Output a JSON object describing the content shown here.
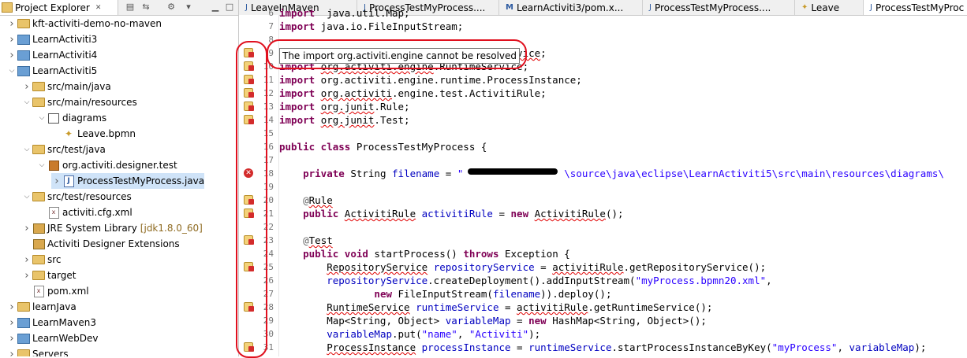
{
  "explorer": {
    "tab_label": "Project Explorer",
    "tab_close": "✕",
    "items": [
      {
        "label": "kft-activiti-demo-no-maven",
        "icon": "project-icon",
        "level": 0,
        "expanded": false,
        "selected": false
      },
      {
        "label": "LearnActiviti3",
        "icon": "maven-project-icon",
        "level": 0,
        "expanded": false,
        "selected": false
      },
      {
        "label": "LearnActiviti4",
        "icon": "maven-project-icon",
        "level": 0,
        "expanded": false,
        "selected": false
      },
      {
        "label": "LearnActiviti5",
        "icon": "maven-project-icon",
        "level": 0,
        "expanded": true,
        "selected": false
      },
      {
        "label": "src/main/java",
        "icon": "source-folder-icon",
        "level": 1,
        "expanded": false,
        "selected": false
      },
      {
        "label": "src/main/resources",
        "icon": "source-folder-icon",
        "level": 1,
        "expanded": true,
        "selected": false
      },
      {
        "label": "diagrams",
        "icon": "diagram-folder-icon",
        "level": 2,
        "expanded": true,
        "selected": false
      },
      {
        "label": "Leave.bpmn",
        "icon": "bpmn-file-icon",
        "level": 3,
        "expanded": null,
        "selected": false
      },
      {
        "label": "src/test/java",
        "icon": "source-folder-icon",
        "level": 1,
        "expanded": true,
        "selected": false
      },
      {
        "label": "org.activiti.designer.test",
        "icon": "package-icon",
        "level": 2,
        "expanded": true,
        "selected": false
      },
      {
        "label": "ProcessTestMyProcess.java",
        "icon": "java-file-icon",
        "level": 3,
        "expanded": false,
        "selected": true
      },
      {
        "label": "src/test/resources",
        "icon": "source-folder-icon",
        "level": 1,
        "expanded": true,
        "selected": false
      },
      {
        "label": "activiti.cfg.xml",
        "icon": "xml-file-icon",
        "level": 2,
        "expanded": null,
        "selected": false
      },
      {
        "label": "JRE System Library",
        "decoration": "[jdk1.8.0_60]",
        "icon": "library-icon",
        "level": 1,
        "expanded": false,
        "selected": false
      },
      {
        "label": "Activiti Designer Extensions",
        "icon": "library-icon",
        "level": 1,
        "expanded": null,
        "selected": false
      },
      {
        "label": "src",
        "icon": "folder-icon",
        "level": 1,
        "expanded": false,
        "selected": false
      },
      {
        "label": "target",
        "icon": "folder-icon",
        "level": 1,
        "expanded": false,
        "selected": false
      },
      {
        "label": "pom.xml",
        "icon": "xml-file-icon",
        "level": 1,
        "expanded": null,
        "selected": false
      },
      {
        "label": "learnJava",
        "icon": "project-icon",
        "level": 0,
        "expanded": false,
        "selected": false
      },
      {
        "label": "LearnMaven3",
        "icon": "maven-project-icon",
        "level": 0,
        "expanded": false,
        "selected": false
      },
      {
        "label": "LearnWebDev",
        "icon": "maven-project-icon",
        "level": 0,
        "expanded": false,
        "selected": false
      },
      {
        "label": "Servers",
        "icon": "folder-icon",
        "level": 0,
        "expanded": false,
        "selected": false
      }
    ]
  },
  "editor": {
    "tabs": [
      {
        "label": "LeaveInMaven",
        "icon": "java-file-icon",
        "active": false
      },
      {
        "label": "ProcessTestMyProcess....",
        "icon": "java-file-icon",
        "active": false
      },
      {
        "label": "LearnActiviti3/pom.x...",
        "icon": "maven-pom-icon",
        "active": false
      },
      {
        "label": "ProcessTestMyProcess....",
        "icon": "java-file-icon",
        "active": false
      },
      {
        "label": "Leave",
        "icon": "bpmn-file-icon",
        "active": false
      },
      {
        "label": "ProcessTestMyProc",
        "icon": "java-file-icon",
        "active": true
      }
    ],
    "tooltip": "The import org.activiti.engine cannot be resolved",
    "lines": [
      {
        "n": "6",
        "marker": null,
        "segs": [
          [
            "kw",
            "import"
          ],
          [
            "",
            "  java.util.Map;"
          ]
        ]
      },
      {
        "n": "7",
        "marker": null,
        "segs": [
          [
            "kw",
            "import"
          ],
          [
            "",
            " java.io.FileInputStream;"
          ]
        ]
      },
      {
        "n": "8",
        "marker": null,
        "segs": []
      },
      {
        "n": "9",
        "marker": "warn",
        "segs": [
          [
            "kw",
            "import"
          ],
          [
            "",
            " org.activiti.engine.Repository"
          ],
          [
            "err",
            "Service"
          ],
          [
            "",
            ";"
          ]
        ]
      },
      {
        "n": "10",
        "marker": "warn",
        "segs": [
          [
            "kw",
            "import"
          ],
          [
            "",
            " "
          ],
          [
            "err",
            "org.activiti.engine"
          ],
          [
            "",
            ".RuntimeService;"
          ]
        ]
      },
      {
        "n": "11",
        "marker": "warn",
        "segs": [
          [
            "kw",
            "import"
          ],
          [
            "",
            " org.activiti.engine.runtime.ProcessInstance;"
          ]
        ]
      },
      {
        "n": "12",
        "marker": "warn",
        "segs": [
          [
            "kw",
            "import"
          ],
          [
            "",
            " "
          ],
          [
            "err",
            "org.activiti"
          ],
          [
            "",
            ".engine.test.ActivitiRule;"
          ]
        ]
      },
      {
        "n": "13",
        "marker": "warn",
        "segs": [
          [
            "kw",
            "import"
          ],
          [
            "",
            " "
          ],
          [
            "err",
            "org.junit"
          ],
          [
            "",
            ".Rule;"
          ]
        ]
      },
      {
        "n": "14",
        "marker": "warn",
        "segs": [
          [
            "kw",
            "import"
          ],
          [
            "",
            " "
          ],
          [
            "err",
            "org.junit"
          ],
          [
            "",
            ".Test;"
          ]
        ]
      },
      {
        "n": "15",
        "marker": null,
        "segs": []
      },
      {
        "n": "16",
        "marker": null,
        "segs": [
          [
            "kw",
            "public class"
          ],
          [
            "",
            " ProcessTestMyProcess {"
          ]
        ]
      },
      {
        "n": "17",
        "marker": null,
        "segs": []
      },
      {
        "n": "18",
        "marker": "err",
        "segs": [
          [
            "",
            "    "
          ],
          [
            "kw",
            "private"
          ],
          [
            "",
            " String "
          ],
          [
            "fld",
            "filename"
          ],
          [
            "",
            " = "
          ],
          [
            "str",
            "\"                 \\source\\java\\eclipse\\LearnActiviti5\\src\\main\\resources\\diagrams\\"
          ]
        ]
      },
      {
        "n": "19",
        "marker": null,
        "segs": []
      },
      {
        "n": "20",
        "marker": "warn",
        "segs": [
          [
            "",
            "    "
          ],
          [
            "ann",
            "@"
          ],
          [
            "err",
            "Rule"
          ]
        ]
      },
      {
        "n": "21",
        "marker": "warn",
        "segs": [
          [
            "",
            "    "
          ],
          [
            "kw",
            "public"
          ],
          [
            "",
            " "
          ],
          [
            "err",
            "ActivitiRule"
          ],
          [
            "",
            " "
          ],
          [
            "fld",
            "activitiRule"
          ],
          [
            "",
            " = "
          ],
          [
            "kw",
            "new"
          ],
          [
            "",
            " "
          ],
          [
            "err",
            "ActivitiRule"
          ],
          [
            "",
            "();"
          ]
        ]
      },
      {
        "n": "22",
        "marker": null,
        "segs": []
      },
      {
        "n": "23",
        "marker": "warn",
        "segs": [
          [
            "",
            "    "
          ],
          [
            "ann",
            "@"
          ],
          [
            "err",
            "Test"
          ]
        ]
      },
      {
        "n": "24",
        "marker": null,
        "segs": [
          [
            "",
            "    "
          ],
          [
            "kw",
            "public void"
          ],
          [
            "",
            " startProcess() "
          ],
          [
            "kw",
            "throws"
          ],
          [
            "",
            " Exception {"
          ]
        ]
      },
      {
        "n": "25",
        "marker": "warn",
        "segs": [
          [
            "",
            "        "
          ],
          [
            "err",
            "RepositoryService"
          ],
          [
            "",
            " "
          ],
          [
            "fld",
            "repositoryService"
          ],
          [
            "",
            " = "
          ],
          [
            "err",
            "activitiRule"
          ],
          [
            "",
            ".getRepositoryService();"
          ]
        ]
      },
      {
        "n": "26",
        "marker": null,
        "segs": [
          [
            "",
            "        "
          ],
          [
            "fld",
            "repositoryService"
          ],
          [
            "",
            ".createDeployment().addInputStream("
          ],
          [
            "str",
            "\"myProcess.bpmn20.xml\""
          ],
          [
            "",
            ","
          ]
        ]
      },
      {
        "n": "27",
        "marker": null,
        "segs": [
          [
            "",
            "                "
          ],
          [
            "kw",
            "new"
          ],
          [
            "",
            " FileInputStream("
          ],
          [
            "fld",
            "filename"
          ],
          [
            "",
            ")).deploy();"
          ]
        ]
      },
      {
        "n": "28",
        "marker": "warn",
        "segs": [
          [
            "",
            "        "
          ],
          [
            "err",
            "RuntimeService"
          ],
          [
            "",
            " "
          ],
          [
            "fld",
            "runtimeService"
          ],
          [
            "",
            " = "
          ],
          [
            "err",
            "activitiRule"
          ],
          [
            "",
            ".getRuntimeService();"
          ]
        ]
      },
      {
        "n": "29",
        "marker": null,
        "segs": [
          [
            "",
            "        Map<String, Object> "
          ],
          [
            "fld",
            "variableMap"
          ],
          [
            "",
            " = "
          ],
          [
            "kw",
            "new"
          ],
          [
            "",
            " HashMap<String, Object>();"
          ]
        ]
      },
      {
        "n": "30",
        "marker": null,
        "segs": [
          [
            "",
            "        "
          ],
          [
            "fld",
            "variableMap"
          ],
          [
            "",
            ".put("
          ],
          [
            "str",
            "\"name\""
          ],
          [
            "",
            ", "
          ],
          [
            "str",
            "\"Activiti\""
          ],
          [
            "",
            ");"
          ]
        ]
      },
      {
        "n": "31",
        "marker": "warn",
        "segs": [
          [
            "",
            "        "
          ],
          [
            "err",
            "ProcessInstance"
          ],
          [
            "",
            " "
          ],
          [
            "fld",
            "processInstance"
          ],
          [
            "",
            " = "
          ],
          [
            "fld",
            "runtimeService"
          ],
          [
            "",
            ".startProcessInstanceByKey("
          ],
          [
            "str",
            "\"myProcess\""
          ],
          [
            "",
            ", "
          ],
          [
            "fld",
            "variableMap"
          ],
          [
            "",
            ");"
          ]
        ]
      }
    ]
  }
}
